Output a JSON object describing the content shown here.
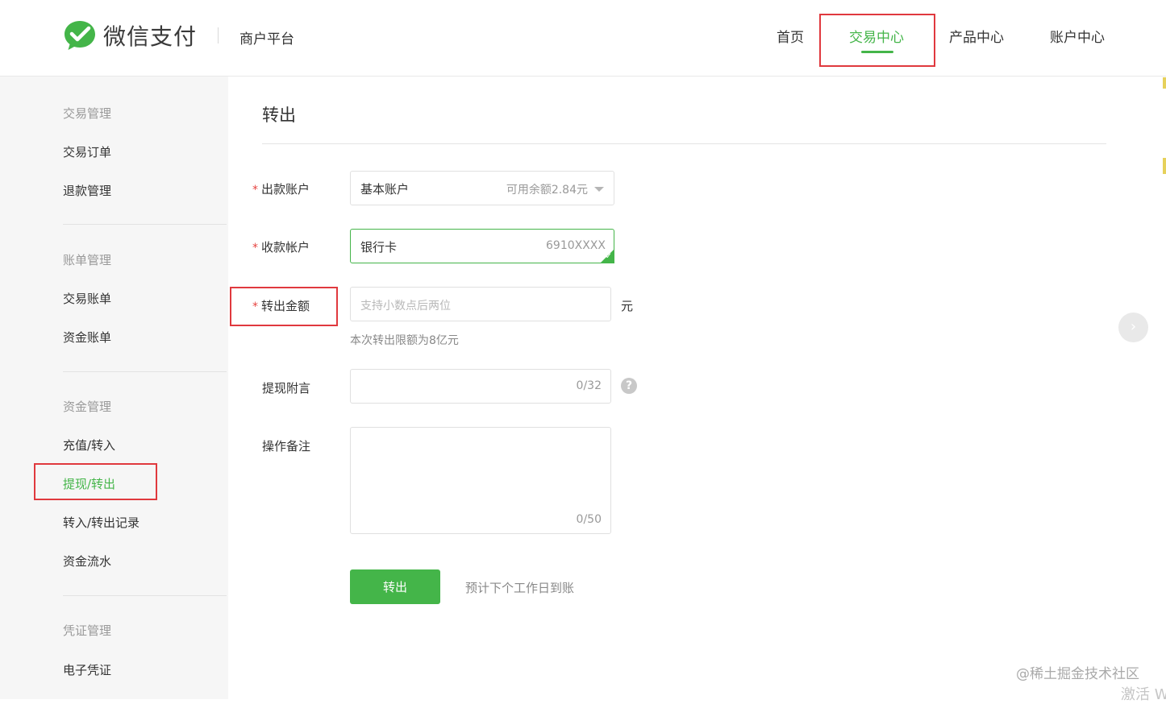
{
  "header": {
    "brand": "微信支付",
    "platform": "商户平台",
    "nav": [
      "首页",
      "交易中心",
      "产品中心",
      "账户中心"
    ],
    "active_nav": "交易中心"
  },
  "sidebar": {
    "groups": [
      {
        "title": "交易管理",
        "items": [
          "交易订单",
          "退款管理"
        ]
      },
      {
        "title": "账单管理",
        "items": [
          "交易账单",
          "资金账单"
        ]
      },
      {
        "title": "资金管理",
        "items": [
          "充值/转入",
          "提现/转出",
          "转入/转出记录",
          "资金流水"
        ]
      },
      {
        "title": "凭证管理",
        "items": [
          "电子凭证"
        ]
      }
    ],
    "active_item": "提现/转出"
  },
  "main": {
    "title": "转出",
    "fields": {
      "from_account": {
        "label": "出款账户",
        "required": true,
        "value": "基本账户",
        "hint": "可用余额2.84元"
      },
      "to_account": {
        "label": "收款帐户",
        "required": true,
        "value": "银行卡",
        "hint": "6910XXXX"
      },
      "amount": {
        "label": "转出金额",
        "required": true,
        "placeholder": "支持小数点后两位",
        "unit": "元",
        "note": "本次转出限额为8亿元"
      },
      "remark": {
        "label": "提现附言",
        "counter": "0/32",
        "help": "?"
      },
      "memo": {
        "label": "操作备注",
        "counter": "0/50"
      }
    },
    "submit_label": "转出",
    "submit_note": "预计下个工作日到账"
  },
  "overlay": {
    "watermark": "@稀土掘金技术社区",
    "activate_text": "激活 W"
  },
  "colors": {
    "accent": "#44b549",
    "annotation": "#e0393e",
    "required": "#e64340"
  }
}
